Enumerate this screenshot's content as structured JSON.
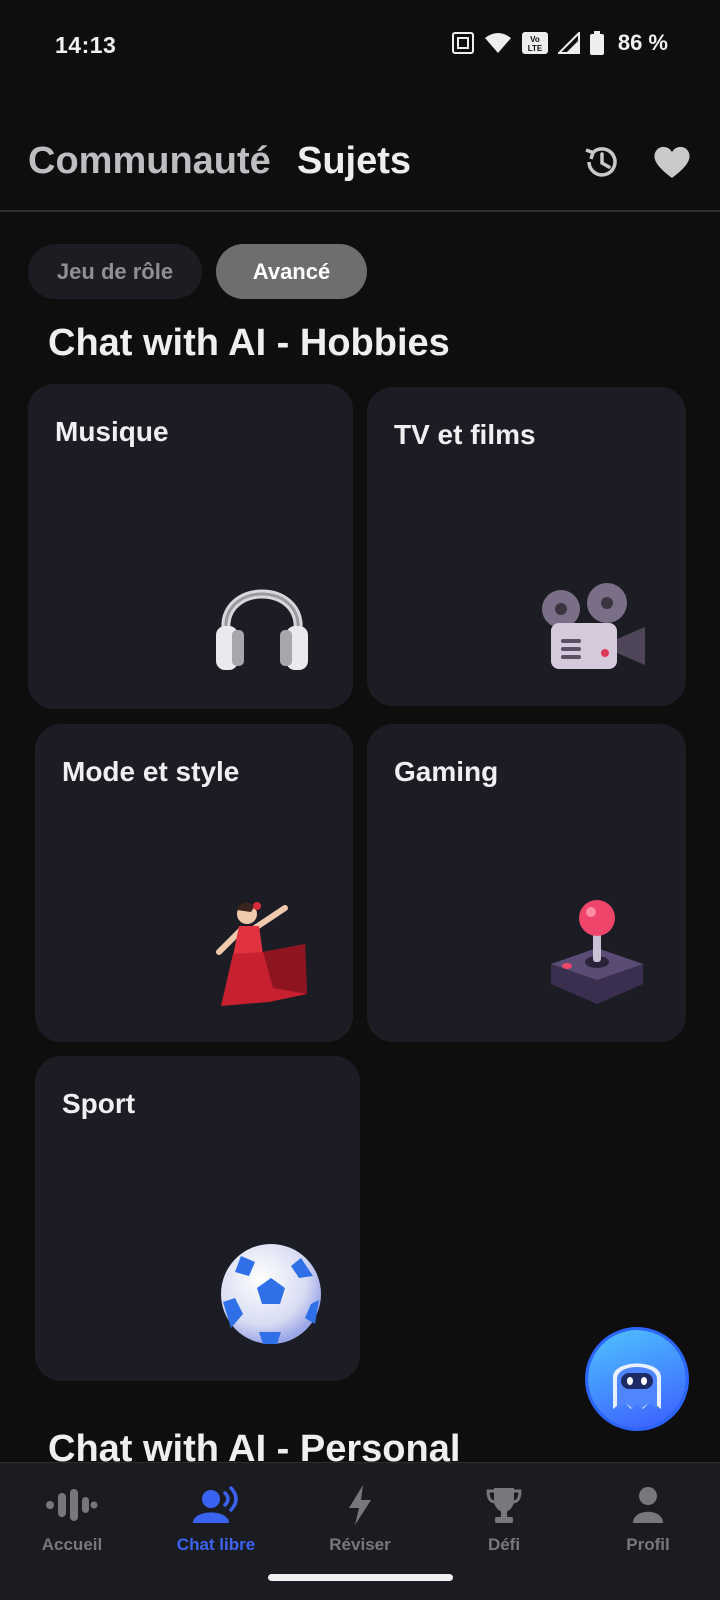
{
  "status": {
    "time": "14:13",
    "battery_pct": "86 %"
  },
  "header": {
    "tabs": [
      {
        "label": "Communauté"
      },
      {
        "label": "Sujets"
      }
    ],
    "icons": {
      "history": "history-icon",
      "favorites": "heart-icon"
    }
  },
  "chips": [
    {
      "label": "Jeu de rôle"
    },
    {
      "label": "Avancé"
    }
  ],
  "sections": [
    {
      "title": "Chat with AI - Hobbies",
      "cards": [
        {
          "title": "Musique",
          "icon": "headphones-icon"
        },
        {
          "title": "TV et films",
          "icon": "film-projector-icon"
        },
        {
          "title": "Mode et style",
          "icon": "dancer-icon"
        },
        {
          "title": "Gaming",
          "icon": "joystick-icon"
        },
        {
          "title": "Sport",
          "icon": "soccer-ball-icon"
        }
      ]
    },
    {
      "title": "Chat with AI - Personal"
    }
  ],
  "fab": {
    "icon": "chat-bot-icon"
  },
  "bottom_nav": [
    {
      "label": "Accueil",
      "icon": "soundwave-icon"
    },
    {
      "label": "Chat libre",
      "icon": "speaking-person-icon",
      "active": true
    },
    {
      "label": "Réviser",
      "icon": "lightning-icon"
    },
    {
      "label": "Défi",
      "icon": "trophy-icon"
    },
    {
      "label": "Profil",
      "icon": "person-icon"
    }
  ],
  "colors": {
    "accent": "#3b63f2",
    "card_bg": "#1c1d24",
    "background": "#0e0e0f"
  }
}
